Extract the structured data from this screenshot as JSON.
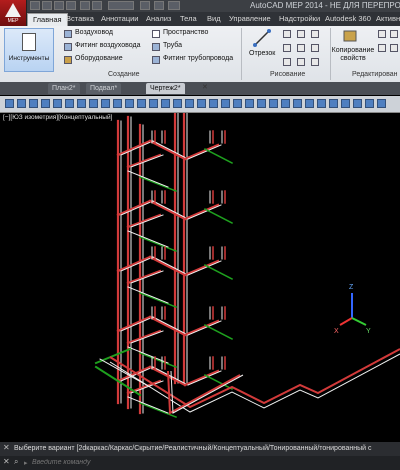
{
  "app": {
    "logo_label": "MEP",
    "title": "AutoCAD MEP 2014 - НЕ ДЛЯ ПЕРЕПРО"
  },
  "ribbon_tabs": [
    "Главная",
    "Вставка",
    "Аннотации",
    "Анализ",
    "Тела",
    "Вид",
    "Управление",
    "Надстройки",
    "Autodesk 360",
    "Активн"
  ],
  "ribbon": {
    "instruments_label": "Инструменты",
    "col1": [
      "Воздуховод",
      "Фитинг воздуховода",
      "Оборудование"
    ],
    "col2": [
      "Пространство",
      "Труба",
      "Фитинг трубопровода"
    ],
    "segment_label": "Отрезок",
    "copy_props_label": "Копирование свойств",
    "panels": {
      "create": "Создание",
      "draw": "Рисование",
      "edit": "Редактирован"
    }
  },
  "file_tabs": [
    "План2*",
    "Подвал*",
    "Чертеж2*"
  ],
  "viewport": {
    "label": "[−][ЮЗ изометрия][Концептуальный]",
    "ucs": {
      "x_label": "X",
      "y_label": "Y",
      "z_label": "Z"
    }
  },
  "command": {
    "line": "Выберите вариант  [2dкаркас/Каркас/Скрытие/Реалистичный/Концептуальный/Тонированный/тонированный с",
    "prompt_placeholder": "Введите команду"
  },
  "colors": {
    "pipe_red": "#d23a3a",
    "pipe_white": "#f0f0f0",
    "pipe_green": "#1ea01e",
    "ucs_x": "#e33",
    "ucs_y": "#3c3",
    "ucs_z": "#36f"
  }
}
